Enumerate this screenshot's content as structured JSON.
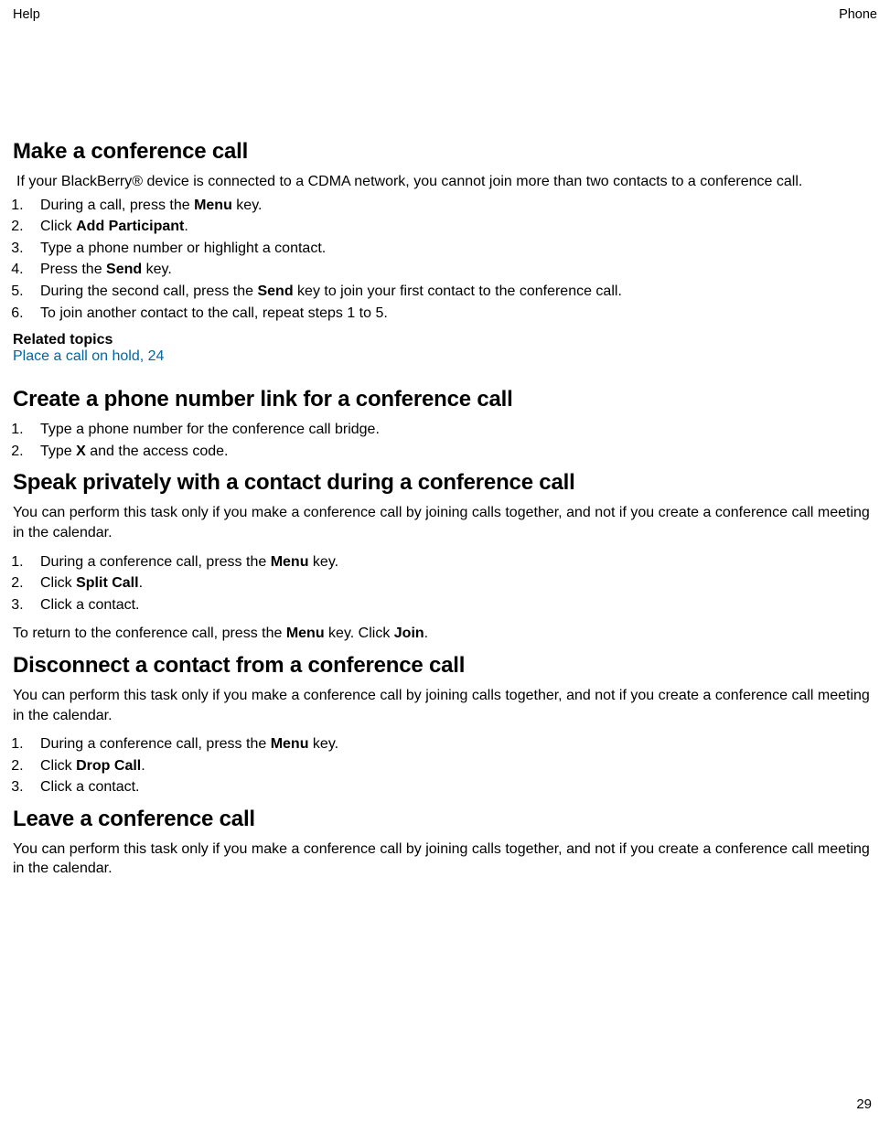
{
  "header": {
    "left": "Help",
    "right": "Phone"
  },
  "page_number": "29",
  "sections": {
    "s1": {
      "title": "Make a conference call",
      "intro": "If your BlackBerry® device is connected to a CDMA network, you cannot join more than two contacts to a conference call.",
      "steps": {
        "i1a": "During a call, press the ",
        "i1b": "Menu",
        "i1c": " key.",
        "i2a": "Click ",
        "i2b": "Add Participant",
        "i2c": ".",
        "i3": "Type a phone number or highlight a contact.",
        "i4a": "Press the ",
        "i4b": "Send",
        "i4c": " key.",
        "i5a": "During the second call, press the ",
        "i5b": "Send",
        "i5c": " key to join your first contact to the conference call.",
        "i6": "To join another contact to the call, repeat steps 1 to 5."
      },
      "related_heading": "Related topics",
      "related_link": "Place a call on hold, 24"
    },
    "s2": {
      "title": "Create a phone number link for a conference call",
      "steps": {
        "i1": "Type a phone number for the conference call bridge.",
        "i2a": "Type ",
        "i2b": "X",
        "i2c": " and the access code."
      }
    },
    "s3": {
      "title": "Speak privately with a contact during a conference call",
      "intro": "You can perform this task only if you make a conference call by joining calls together, and not if you create a conference call meeting in the calendar.",
      "steps": {
        "i1a": "During a conference call, press the ",
        "i1b": "Menu",
        "i1c": " key.",
        "i2a": "Click ",
        "i2b": "Split Call",
        "i2c": ".",
        "i3": "Click a contact."
      },
      "outro_a": "To return to the conference call, press the ",
      "outro_b": "Menu",
      "outro_c": " key. Click ",
      "outro_d": "Join",
      "outro_e": "."
    },
    "s4": {
      "title": "Disconnect a contact from a conference call",
      "intro": "You can perform this task only if you make a conference call by joining calls together, and not if you create a conference call meeting in the calendar.",
      "steps": {
        "i1a": "During a conference call, press the ",
        "i1b": "Menu",
        "i1c": " key.",
        "i2a": "Click ",
        "i2b": "Drop Call",
        "i2c": ".",
        "i3": "Click a contact."
      }
    },
    "s5": {
      "title": "Leave a conference call",
      "intro": "You can perform this task only if you make a conference call by joining calls together, and not if you create a conference call meeting in the calendar."
    }
  }
}
